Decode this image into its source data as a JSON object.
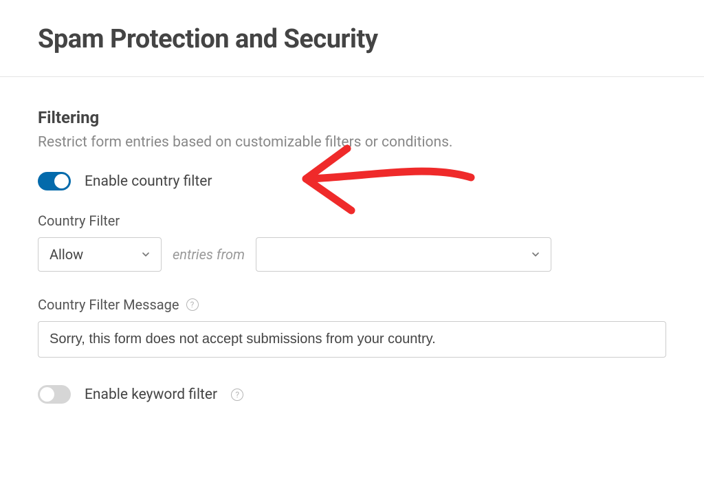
{
  "page": {
    "title": "Spam Protection and Security"
  },
  "filtering": {
    "section_title": "Filtering",
    "section_description": "Restrict form entries based on customizable filters or conditions.",
    "enable_country_label": "Enable country filter",
    "enable_country_on": true,
    "country_filter_label": "Country Filter",
    "allow_deny_value": "Allow",
    "entries_from_text": "entries from",
    "countries_value": "",
    "message_label": "Country Filter Message",
    "message_value": "Sorry, this form does not accept submissions from your country.",
    "enable_keyword_label": "Enable keyword filter",
    "enable_keyword_on": false
  }
}
